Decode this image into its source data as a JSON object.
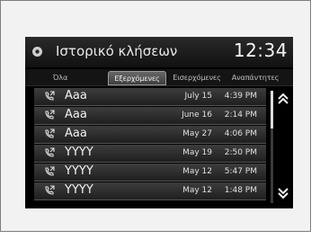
{
  "header": {
    "title": "Ιστορικό κλήσεων",
    "clock": "12:34",
    "icon": "phone-settings-icon"
  },
  "tabs": [
    {
      "label": "Όλα",
      "active": false
    },
    {
      "label": "Εξερχόμενες",
      "active": true
    },
    {
      "label": "Εισερχόμενες",
      "active": false
    },
    {
      "label": "Αναπάντητες",
      "active": false
    }
  ],
  "calls": [
    {
      "name": "Aaa",
      "date": "July 15",
      "time": "4:39 PM",
      "type": "outgoing-call-icon"
    },
    {
      "name": "Aaa",
      "date": "June 16",
      "time": "2:14 PM",
      "type": "outgoing-call-icon"
    },
    {
      "name": "Aaa",
      "date": "May 27",
      "time": "4:06 PM",
      "type": "outgoing-call-icon"
    },
    {
      "name": "YYYY",
      "date": "May 19",
      "time": "2:50 PM",
      "type": "outgoing-call-icon"
    },
    {
      "name": "YYYY",
      "date": "May 12",
      "time": "5:47 PM",
      "type": "outgoing-call-icon"
    },
    {
      "name": "YYYY",
      "date": "May 12",
      "time": "1:48 PM",
      "type": "outgoing-call-icon"
    }
  ],
  "scroll": {
    "up_icon": "double-chevron-up-icon",
    "down_icon": "double-chevron-down-icon"
  },
  "colors": {
    "screen_bg": "#000000",
    "row_bg": "#2e2e2e",
    "text": "#f2f2f2"
  }
}
